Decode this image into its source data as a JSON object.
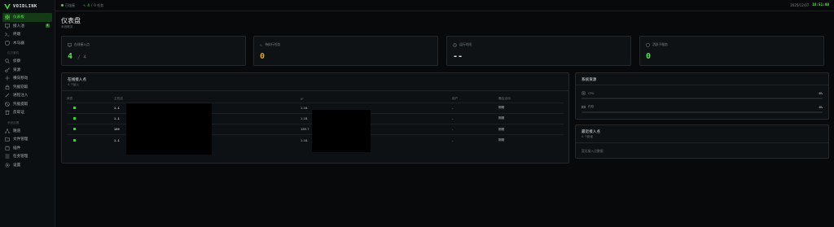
{
  "app": {
    "name": "VOIDLINK"
  },
  "sidebar": {
    "items_top": [
      {
        "label": "仪表板",
        "icon": "grid-icon",
        "active": true
      },
      {
        "label": "接入池",
        "icon": "monitor-icon",
        "badge": "4"
      },
      {
        "label": "终端",
        "icon": "terminal-icon"
      },
      {
        "label": "木马器",
        "icon": "shield-icon"
      }
    ],
    "section1_label": "红方套件",
    "items_mid": [
      {
        "label": "侦察",
        "icon": "search-icon"
      },
      {
        "label": "资源",
        "icon": "key-icon"
      },
      {
        "label": "横向移动",
        "icon": "move-icon"
      },
      {
        "label": "凭据窃取",
        "icon": "lock-icon"
      },
      {
        "label": "进程注入",
        "icon": "pen-icon"
      },
      {
        "label": "凭据提取",
        "icon": "eye-icon"
      },
      {
        "label": "反取证",
        "icon": "trash-icon"
      }
    ],
    "section2_label": "系统设置",
    "items_bottom": [
      {
        "label": "隧道",
        "icon": "tunnel-icon"
      },
      {
        "label": "文件管理",
        "icon": "folder-icon"
      },
      {
        "label": "插件",
        "icon": "plugin-icon"
      },
      {
        "label": "任务管理",
        "icon": "tasks-icon"
      },
      {
        "label": "设置",
        "icon": "gear-icon"
      }
    ]
  },
  "topbar": {
    "status": "已连接",
    "agents_count": "4",
    "tasks_label": "0 任务",
    "date": "2025/12/07",
    "time": "18:51:00"
  },
  "page": {
    "title": "仪表盘",
    "subtitle": "系统概览"
  },
  "stats": [
    {
      "label": "在线接入点",
      "value": "4",
      "total": "4",
      "color": "#57e251",
      "icon": "monitor-icon"
    },
    {
      "label": "待执行任务",
      "value": "0",
      "color": "#e0a21f",
      "icon": "activity-icon"
    },
    {
      "label": "运行时间",
      "value": "--",
      "color": "#dfe6e9",
      "icon": "clock-icon"
    },
    {
      "label": "活跃子服务",
      "value": "0",
      "color": "#57e251",
      "icon": "shield-icon"
    }
  ],
  "online_hosts": {
    "title": "在线接入点",
    "subtitle": "4 个接入",
    "columns": [
      "状态",
      "主机名",
      "IP",
      "用户",
      "最后活动"
    ],
    "rows": [
      {
        "host": "1.1",
        "ip": "1.18.",
        "user": "-",
        "last": "刚刚"
      },
      {
        "host": "1.1",
        "ip": "1.18.",
        "user": "-",
        "last": "刚刚"
      },
      {
        "host": "189",
        "ip": "189.7",
        "user": "-",
        "last": "刚刚"
      },
      {
        "host": "1.1",
        "ip": "1.18.",
        "user": "-",
        "last": "刚刚"
      }
    ]
  },
  "resources": {
    "title": "系统资源",
    "items": [
      {
        "label": "CPU",
        "value": "0%",
        "percent": 0,
        "icon": "cpu-icon"
      },
      {
        "label": "内存",
        "value": "0%",
        "percent": 0,
        "icon": "memory-icon"
      }
    ]
  },
  "recent_hosts": {
    "title": "最近接入点",
    "subtitle": "0 个新增",
    "empty": "暂无接入点数据"
  }
}
